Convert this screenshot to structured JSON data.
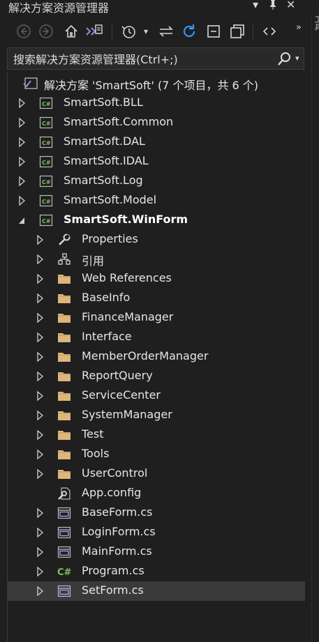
{
  "titlebar": {
    "title": "解决方案资源管理器",
    "controls": {
      "dropdown": "▾",
      "pin": "📌",
      "close": "✕"
    }
  },
  "toolbar": {
    "buttons": [
      {
        "name": "back-button",
        "glyph": "←",
        "dim": true
      },
      {
        "name": "forward-button",
        "glyph": "→",
        "dim": true
      },
      {
        "name": "home-button",
        "glyph": "⌂"
      },
      {
        "name": "switch-views-button",
        "glyph": "VS"
      },
      {
        "name": "pending-changes-filter-button",
        "glyph": "⟲"
      },
      {
        "name": "pending-changes-dropdown",
        "glyph": "▾"
      },
      {
        "name": "sync-with-document-button",
        "glyph": "⇆"
      },
      {
        "name": "refresh-button",
        "glyph": "↻"
      },
      {
        "name": "collapse-all-button",
        "glyph": "▭"
      },
      {
        "name": "show-all-files-button",
        "glyph": "⧉"
      },
      {
        "name": "code-view-button",
        "glyph": "‹›"
      }
    ],
    "overflow": "»"
  },
  "search": {
    "placeholder": "搜索解决方案资源管理器(Ctrl+;)",
    "icon": "search-icon"
  },
  "tree": {
    "solution": {
      "label": "解决方案 'SmartSoft' (7 个项目，共 6 个)",
      "icon": "solution-icon"
    },
    "items": [
      {
        "label": "SmartSoft.BLL",
        "icon": "csharp-project-icon",
        "level": 1,
        "expander": "collapsed"
      },
      {
        "label": "SmartSoft.Common",
        "icon": "csharp-project-icon",
        "level": 1,
        "expander": "collapsed"
      },
      {
        "label": "SmartSoft.DAL",
        "icon": "csharp-project-icon",
        "level": 1,
        "expander": "collapsed"
      },
      {
        "label": "SmartSoft.IDAL",
        "icon": "csharp-project-icon",
        "level": 1,
        "expander": "collapsed"
      },
      {
        "label": "SmartSoft.Log",
        "icon": "csharp-project-icon",
        "level": 1,
        "expander": "collapsed"
      },
      {
        "label": "SmartSoft.Model",
        "icon": "csharp-project-icon",
        "level": 1,
        "expander": "collapsed"
      },
      {
        "label": "SmartSoft.WinForm",
        "icon": "csharp-project-icon",
        "level": 1,
        "expander": "expanded",
        "bold": true
      },
      {
        "label": "Properties",
        "icon": "wrench-icon",
        "level": 2,
        "expander": "collapsed"
      },
      {
        "label": "引用",
        "icon": "references-icon",
        "level": 2,
        "expander": "collapsed"
      },
      {
        "label": "Web References",
        "icon": "folder-icon",
        "level": 2,
        "expander": "collapsed"
      },
      {
        "label": "BaseInfo",
        "icon": "folder-icon",
        "level": 2,
        "expander": "collapsed"
      },
      {
        "label": "FinanceManager",
        "icon": "folder-icon",
        "level": 2,
        "expander": "collapsed"
      },
      {
        "label": "Interface",
        "icon": "folder-icon",
        "level": 2,
        "expander": "collapsed"
      },
      {
        "label": "MemberOrderManager",
        "icon": "folder-icon",
        "level": 2,
        "expander": "collapsed"
      },
      {
        "label": "ReportQuery",
        "icon": "folder-icon",
        "level": 2,
        "expander": "collapsed"
      },
      {
        "label": "ServiceCenter",
        "icon": "folder-icon",
        "level": 2,
        "expander": "collapsed"
      },
      {
        "label": "SystemManager",
        "icon": "folder-icon",
        "level": 2,
        "expander": "collapsed"
      },
      {
        "label": "Test",
        "icon": "folder-icon",
        "level": 2,
        "expander": "collapsed"
      },
      {
        "label": "Tools",
        "icon": "folder-icon",
        "level": 2,
        "expander": "collapsed"
      },
      {
        "label": "UserControl",
        "icon": "folder-icon",
        "level": 2,
        "expander": "collapsed"
      },
      {
        "label": "App.config",
        "icon": "config-file-icon",
        "level": 2,
        "expander": "none"
      },
      {
        "label": "BaseForm.cs",
        "icon": "form-icon",
        "level": 2,
        "expander": "collapsed"
      },
      {
        "label": "LoginForm.cs",
        "icon": "form-icon",
        "level": 2,
        "expander": "collapsed"
      },
      {
        "label": "MainForm.cs",
        "icon": "form-icon",
        "level": 2,
        "expander": "collapsed"
      },
      {
        "label": "Program.cs",
        "icon": "csharp-file-icon",
        "level": 2,
        "expander": "collapsed"
      },
      {
        "label": "SetForm.cs",
        "icon": "form-icon",
        "level": 2,
        "expander": "collapsed",
        "selected": true
      }
    ]
  },
  "right_edge_text": "工具",
  "colors": {
    "background": "#1f1f1f",
    "folder": "#dcb67a",
    "csharp": "#7fc15b",
    "form_purple": "#a18ad8",
    "refresh_blue": "#3794ff",
    "selection": "#3a3a3a"
  }
}
